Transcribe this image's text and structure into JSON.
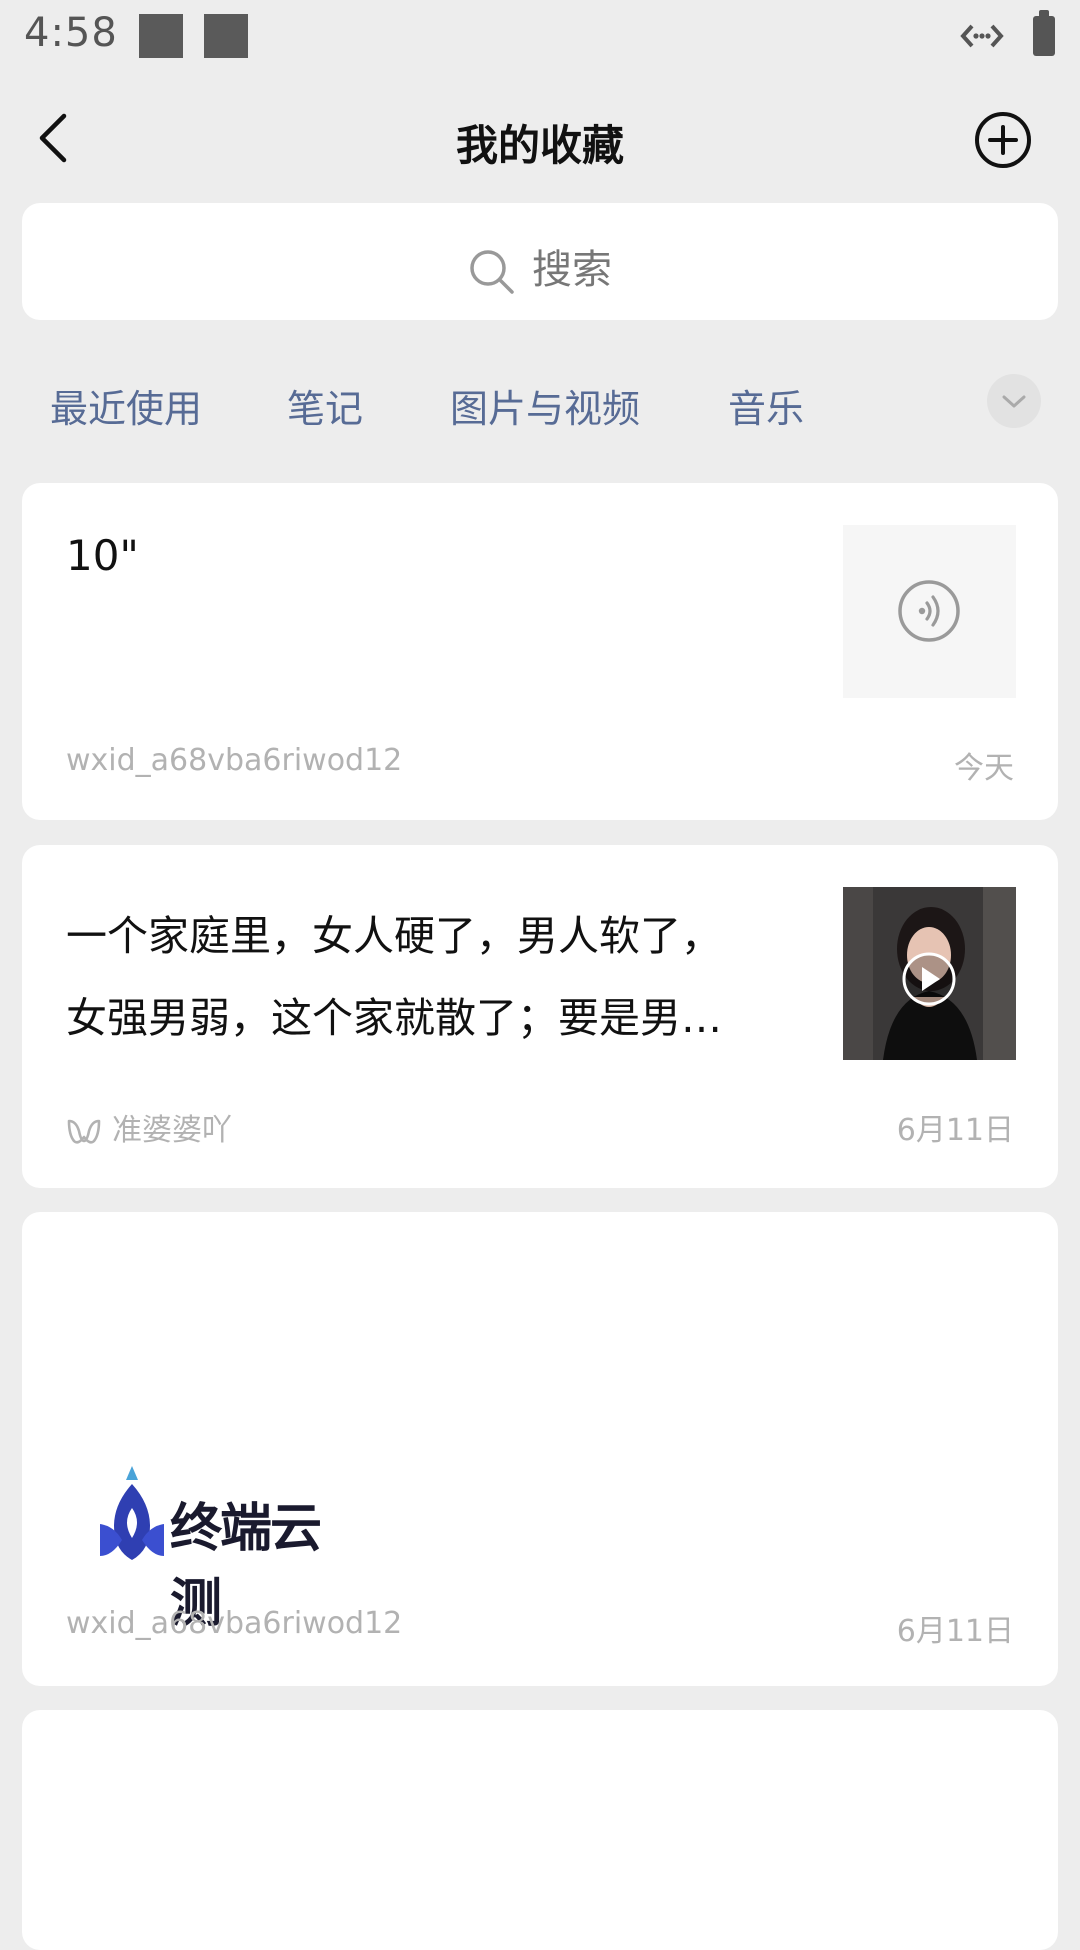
{
  "status_bar": {
    "time": "4:58"
  },
  "header": {
    "title": "我的收藏"
  },
  "search": {
    "placeholder": "搜索"
  },
  "tabs": [
    {
      "label": "最近使用"
    },
    {
      "label": "笔记"
    },
    {
      "label": "图片与视频"
    },
    {
      "label": "音乐"
    }
  ],
  "items": [
    {
      "type": "voice",
      "title": "10\"",
      "source": "wxid_a68vba6riwod12",
      "date": "今天"
    },
    {
      "type": "video",
      "lines": [
        "一个家庭里，女人硬了，男人软了，",
        "女强男弱，这个家就散了；要是男…"
      ],
      "source": "准婆婆吖",
      "source_icon": "channels-icon",
      "date": "6月11日"
    },
    {
      "type": "image",
      "logo_text": "终端云测",
      "source": "wxid_a68vba6riwod12",
      "date": "6月11日"
    }
  ],
  "colors": {
    "accent": "#576b95",
    "background": "#ededed",
    "meta": "#b2b2b2"
  }
}
